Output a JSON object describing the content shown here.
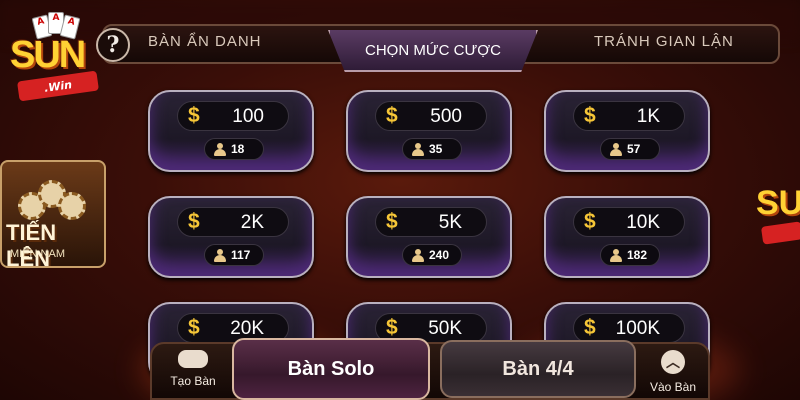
{
  "tabs": [
    {
      "label": "BÀN ẨN DANH",
      "active": false
    },
    {
      "label": "CHỌN MỨC CƯỢC",
      "active": true
    },
    {
      "label": "TRÁNH GIAN LẬN",
      "active": false
    }
  ],
  "help_glyph": "?",
  "logo": {
    "brand": "SUN",
    "tag": ".Win",
    "cards": [
      "A",
      "A",
      "A"
    ]
  },
  "game_badge": {
    "title": "TIẾN LÊN",
    "subtitle": "MIỀN NAM"
  },
  "currency_symbol": "$",
  "bets": [
    {
      "amount": "100",
      "players": "18"
    },
    {
      "amount": "500",
      "players": "35"
    },
    {
      "amount": "1K",
      "players": "57"
    },
    {
      "amount": "2K",
      "players": "117"
    },
    {
      "amount": "5K",
      "players": "240"
    },
    {
      "amount": "10K",
      "players": "182"
    },
    {
      "amount": "20K",
      "players": ""
    },
    {
      "amount": "50K",
      "players": ""
    },
    {
      "amount": "100K",
      "players": ""
    }
  ],
  "bottom": {
    "create_label": "Tạo Bàn",
    "solo_label": "Bàn Solo",
    "four_label": "Bàn 4/4",
    "join_label": "Vào Bàn",
    "join_glyph": "︿"
  },
  "colors": {
    "accent_gold": "#f6c637",
    "card_purple": "#4e2a78",
    "background": "#3a0e08"
  }
}
